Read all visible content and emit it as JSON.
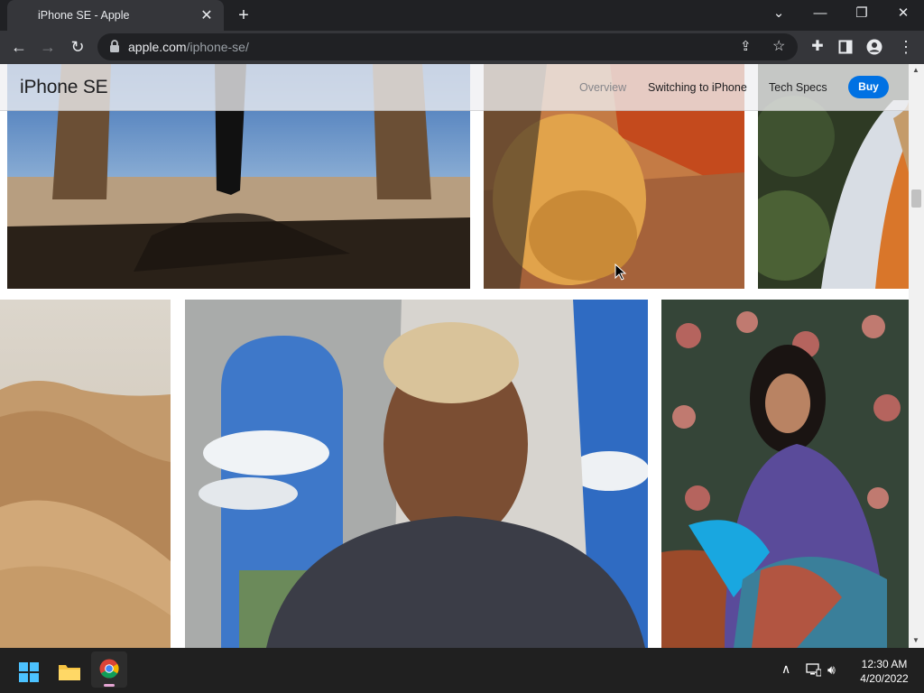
{
  "tab": {
    "title": "iPhone SE - Apple",
    "favicon": "apple-icon"
  },
  "omnibox": {
    "domain": "apple.com",
    "path": "/iphone-se/"
  },
  "localnav": {
    "title": "iPhone SE",
    "links": [
      "Overview",
      "Switching to iPhone",
      "Tech Specs"
    ],
    "buy_label": "Buy",
    "buy_color": "#0071e3"
  },
  "taskbar": {
    "time": "12:30 AM",
    "date": "4/20/2022"
  },
  "colors": {
    "chrome_dark": "#202124",
    "chrome_toolbar": "#35363a",
    "accent": "#0071e3"
  }
}
